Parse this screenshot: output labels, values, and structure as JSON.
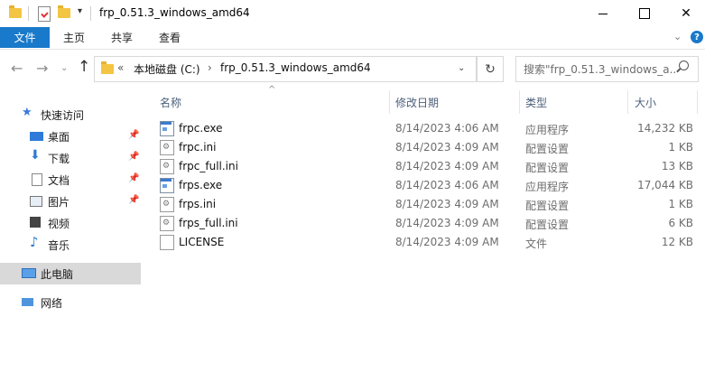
{
  "window": {
    "title": "frp_0.51.3_windows_amd64",
    "controls": {
      "minimize": "—",
      "maximize": "☐",
      "close": "✕"
    }
  },
  "ribbon": {
    "tabs": [
      "文件",
      "主页",
      "共享",
      "查看"
    ],
    "help": "?"
  },
  "addressbar": {
    "overflow": "«",
    "crumbs": [
      "本地磁盘 (C:)",
      "frp_0.51.3_windows_amd64"
    ],
    "separator": "›",
    "search_placeholder": "搜索\"frp_0.51.3_windows_a..."
  },
  "sidebar": {
    "quick_access": "快速访问",
    "pinned": [
      "桌面",
      "下载",
      "文档",
      "图片"
    ],
    "others": [
      "视频",
      "音乐"
    ],
    "this_pc": "此电脑",
    "network": "网络"
  },
  "columns": {
    "name": "名称",
    "date": "修改日期",
    "type": "类型",
    "size": "大小"
  },
  "files": [
    {
      "name": "frpc.exe",
      "date": "8/14/2023 4:06 AM",
      "type": "应用程序",
      "size": "14,232 KB",
      "icon": "exe-icon"
    },
    {
      "name": "frpc.ini",
      "date": "8/14/2023 4:09 AM",
      "type": "配置设置",
      "size": "1 KB",
      "icon": "ini-icon"
    },
    {
      "name": "frpc_full.ini",
      "date": "8/14/2023 4:09 AM",
      "type": "配置设置",
      "size": "13 KB",
      "icon": "ini-icon"
    },
    {
      "name": "frps.exe",
      "date": "8/14/2023 4:06 AM",
      "type": "应用程序",
      "size": "17,044 KB",
      "icon": "exe-icon"
    },
    {
      "name": "frps.ini",
      "date": "8/14/2023 4:09 AM",
      "type": "配置设置",
      "size": "1 KB",
      "icon": "ini-icon"
    },
    {
      "name": "frps_full.ini",
      "date": "8/14/2023 4:09 AM",
      "type": "配置设置",
      "size": "6 KB",
      "icon": "ini-icon"
    },
    {
      "name": "LICENSE",
      "date": "8/14/2023 4:09 AM",
      "type": "文件",
      "size": "12 KB",
      "icon": "file-icon"
    }
  ]
}
